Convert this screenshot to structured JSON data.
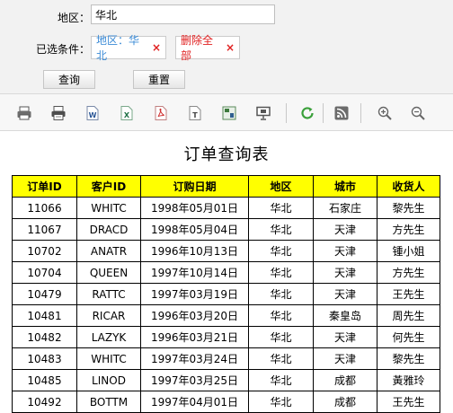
{
  "filter": {
    "region_label": "地区：",
    "region_value": "华北",
    "conditions_label": "已选条件：",
    "chip_region_text": "地区：华北",
    "chip_clear_text": "删除全部",
    "chip_remove_glyph": "×",
    "query_button": "查询",
    "reset_button": "重置"
  },
  "toolbar": {
    "icons": [
      "print-icon",
      "print-preview-icon",
      "export-word-icon",
      "export-excel-icon",
      "export-pdf-icon",
      "export-text-icon",
      "export-image-icon",
      "presentation-icon",
      "refresh-icon",
      "rss-icon",
      "zoom-in-icon",
      "zoom-out-icon"
    ]
  },
  "report": {
    "title": "订单查询表",
    "header_color": "#ffff00",
    "columns": [
      "订单ID",
      "客户ID",
      "订购日期",
      "地区",
      "城市",
      "收货人"
    ],
    "rows": [
      [
        "11066",
        "WHITC",
        "1998年05月01日",
        "华北",
        "石家庄",
        "黎先生"
      ],
      [
        "11067",
        "DRACD",
        "1998年05月04日",
        "华北",
        "天津",
        "方先生"
      ],
      [
        "10702",
        "ANATR",
        "1996年10月13日",
        "华北",
        "天津",
        "锺小姐"
      ],
      [
        "10704",
        "QUEEN",
        "1997年10月14日",
        "华北",
        "天津",
        "方先生"
      ],
      [
        "10479",
        "RATTC",
        "1997年03月19日",
        "华北",
        "天津",
        "王先生"
      ],
      [
        "10481",
        "RICAR",
        "1996年03月20日",
        "华北",
        "秦皇岛",
        "周先生"
      ],
      [
        "10482",
        "LAZYK",
        "1996年03月21日",
        "华北",
        "天津",
        "何先生"
      ],
      [
        "10483",
        "WHITC",
        "1997年03月24日",
        "华北",
        "天津",
        "黎先生"
      ],
      [
        "10485",
        "LINOD",
        "1997年03月25日",
        "华北",
        "成都",
        "黃雅玲"
      ],
      [
        "10492",
        "BOTTM",
        "1997年04月01日",
        "华北",
        "成都",
        "王先生"
      ]
    ]
  }
}
